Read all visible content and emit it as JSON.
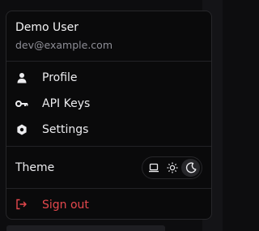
{
  "user": {
    "name": "Demo User",
    "email": "dev@example.com"
  },
  "menu_items": [
    {
      "label": "Profile",
      "icon": "user-icon"
    },
    {
      "label": "API Keys",
      "icon": "key-icon"
    },
    {
      "label": "Settings",
      "icon": "gear-icon"
    }
  ],
  "theme": {
    "label": "Theme",
    "options": [
      {
        "name": "system",
        "icon": "laptop-icon"
      },
      {
        "name": "light",
        "icon": "sun-icon"
      },
      {
        "name": "dark",
        "icon": "moon-icon"
      }
    ],
    "selected": "dark"
  },
  "signout": {
    "label": "Sign out",
    "icon": "logout-icon"
  },
  "colors": {
    "background": "#0a0a0b",
    "border": "#27272a",
    "text": "#ececef",
    "muted": "#8e8e96",
    "danger": "#e5484d"
  }
}
